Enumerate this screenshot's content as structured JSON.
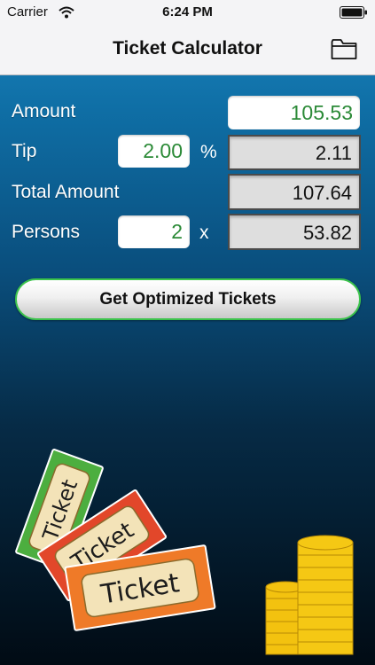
{
  "status_bar": {
    "carrier": "Carrier",
    "time": "6:24 PM",
    "icons": [
      "wifi-icon",
      "battery-icon"
    ]
  },
  "nav": {
    "title": "Ticket Calculator",
    "right_icon": "folder-icon"
  },
  "form": {
    "amount": {
      "label": "Amount",
      "value": "105.53"
    },
    "tip": {
      "label": "Tip",
      "percent_value": "2.00",
      "unit": "%",
      "result": "2.11"
    },
    "total": {
      "label": "Total Amount",
      "value": "107.64"
    },
    "persons": {
      "label": "Persons",
      "value": "2",
      "unit": "x",
      "result": "53.82"
    }
  },
  "action": {
    "optimize_label": "Get Optimized Tickets"
  },
  "illustration": {
    "ticket_word": "Ticket",
    "ticket_colors": [
      "#4cae3f",
      "#e2472a",
      "#ef7a28"
    ],
    "coin_color": "#f3c20f"
  },
  "colors": {
    "accent_green_text": "#2b8a37",
    "button_border": "#3cc34c",
    "background_top": "#1d86c0",
    "background_bottom": "#010b14"
  }
}
